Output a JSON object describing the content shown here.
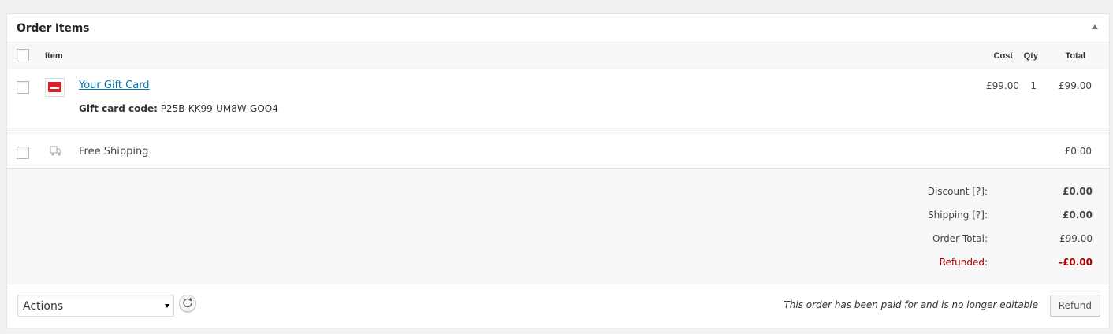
{
  "panel": {
    "title": "Order Items"
  },
  "table": {
    "headers": {
      "item": "Item",
      "cost": "Cost",
      "qty": "Qty",
      "total": "Total"
    },
    "line_item": {
      "name": "Your Gift Card",
      "meta_label": "Gift card code:",
      "meta_value": "P25B-KK99-UM8W-GOO4",
      "cost": "£99.00",
      "qty": "1",
      "total": "£99.00"
    },
    "shipping_item": {
      "name": "Free Shipping",
      "total": "£0.00"
    }
  },
  "totals": {
    "discount_label": "Discount [?]:",
    "discount_value": "£0.00",
    "shipping_label": "Shipping [?]:",
    "shipping_value": "£0.00",
    "order_total_label": "Order Total:",
    "order_total_value": "£99.00",
    "refunded_label": "Refunded:",
    "refunded_value": "-£0.00"
  },
  "footer": {
    "actions_selected": "Actions",
    "note": "This order has been paid for and is no longer editable",
    "refund_label": "Refund"
  },
  "colors": {
    "link": "#0073aa",
    "refunded": "#aa0000",
    "gift_card": "#d3202a"
  }
}
